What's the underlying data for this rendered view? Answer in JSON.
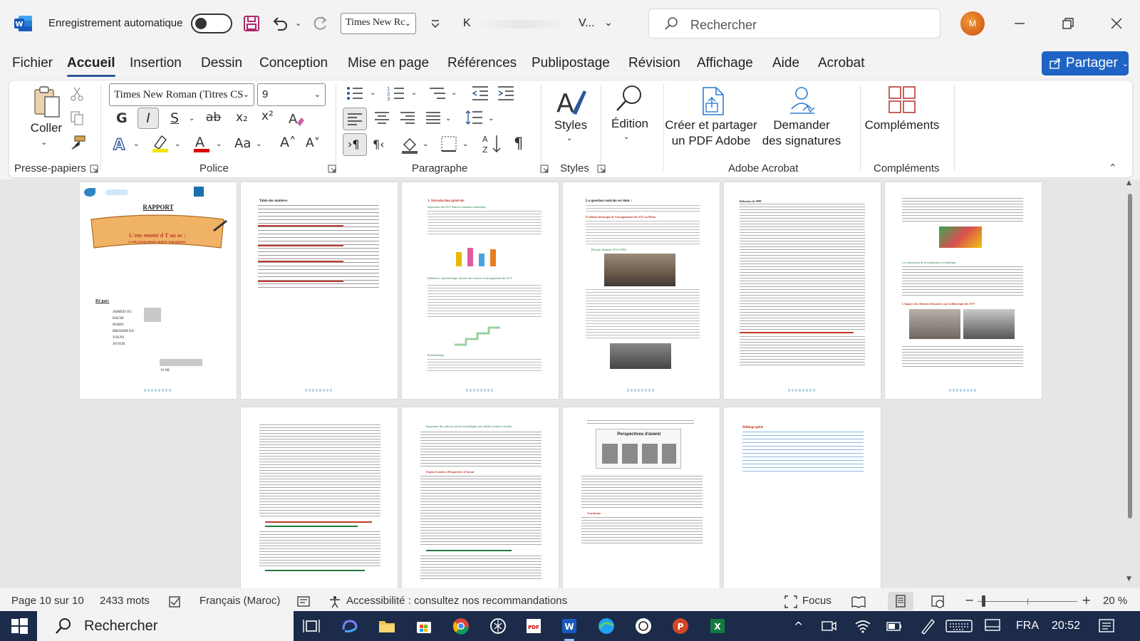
{
  "titlebar": {
    "autosave_label": "Enregistrement automatique",
    "font_name_short": "Times New Rc",
    "doc_title_start": "K",
    "doc_title_end": "V...",
    "search_placeholder": "Rechercher",
    "avatar_initial": "M"
  },
  "tabs": [
    "Fichier",
    "Accueil",
    "Insertion",
    "Dessin",
    "Conception",
    "Mise en page",
    "Références",
    "Publipostage",
    "Révision",
    "Affichage",
    "Aide",
    "Acrobat"
  ],
  "active_tab": "Accueil",
  "share_label": "Partager",
  "ribbon": {
    "paste_label": "Coller",
    "font_name": "Times New Roman (Titres CS",
    "font_size": "9",
    "styles_label": "Styles",
    "edition_label": "Édition",
    "create_pdf_line1": "Créer et partager",
    "create_pdf_line2": "un PDF Adobe",
    "signatures_line1": "Demander",
    "signatures_line2": "des signatures",
    "addins_label": "Compléments",
    "groups": {
      "clipboard": "Presse-papiers",
      "font": "Police",
      "paragraph": "Paragraphe",
      "styles": "Styles",
      "acrobat": "Adobe Acrobat",
      "addins": "Compléments"
    },
    "letters": {
      "bold": "G",
      "italic": "I",
      "underline": "S",
      "strike": "ab",
      "sub": "x₂",
      "sup": "x²",
      "case": "Aa",
      "grow": "A˄",
      "shrink": "A˅"
    }
  },
  "pages": [
    {
      "title": "RAPPORT",
      "banner": "L'ens         ement d          T au       oc :",
      "banner_sub": "Evolu      programme      approc       dagogiques.",
      "authors_label": "Ré         par:",
      "names": [
        "AHMED OU",
        "RACHI",
        "MARW",
        "IBRAHIM DA",
        "YOUNI",
        "AYOUB"
      ],
      "footer": "Pr                   MI"
    },
    {
      "heading": "Table des matières"
    },
    {
      "heading": "1.  Introduction générale",
      "sub1": "Importance des SVT dans la formation scientifique",
      "sub2": "Définition : épistémologie, histoire des sciences et enseignement des SVT",
      "sub3": "Problématique"
    },
    {
      "heading": "La question centrale est donc :",
      "sub1": "Évolution historique de l'enseignement des SVT au Maroc",
      "sub2": "Période coloniale (1912-1956)"
    },
    {
      "heading": "Réformes de 1999"
    },
    {
      "heading": "La construction de la connaissance scientifique",
      "sub1": "L'impact des réformes éducatives sur la didactique des SVT"
    },
    {
      "heading": ""
    },
    {
      "heading": "Importance du cadre les savoirs scientifiques aux réalités sociales et locales",
      "sub1": "Enjeux Actuels et Perspectives d'Avenir"
    },
    {
      "heading": "Perspectives d'avenir",
      "sub1": "Conclusion"
    },
    {
      "heading": "Bibliographie"
    }
  ],
  "status": {
    "page": "Page 10 sur 10",
    "words": "2433 mots",
    "language": "Français (Maroc)",
    "accessibility": "Accessibilité : consultez nos recommandations",
    "focus": "Focus",
    "zoom": "20 %"
  },
  "taskbar": {
    "search_label": "Rechercher",
    "lang": "FRA",
    "time": "20:52"
  },
  "colors": {
    "accent": "#2b579a",
    "share": "#1f64c4",
    "taskbar": "#1c2b4a",
    "heading_red": "#c0392b"
  }
}
